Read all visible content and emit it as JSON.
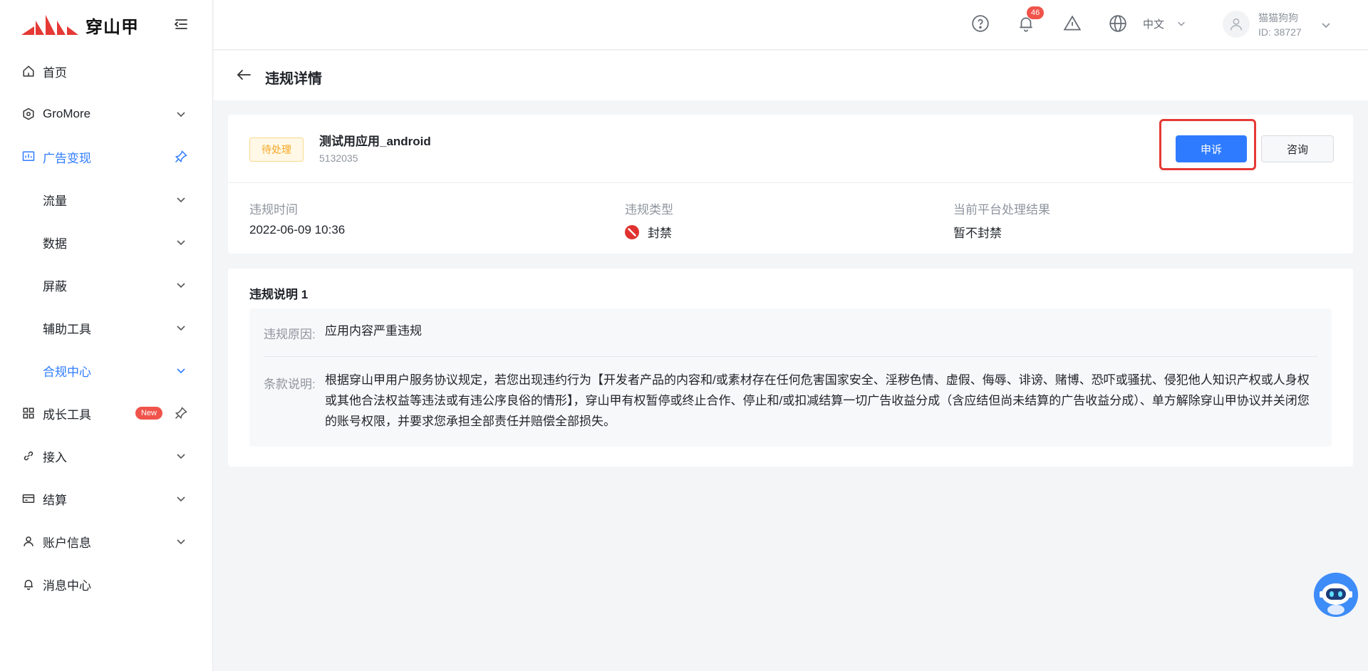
{
  "brand": {
    "name": "穿山甲",
    "accent": "#2e7bff",
    "logo_red": "#e53935"
  },
  "sidebar": {
    "items": [
      {
        "label": "首页",
        "icon": "home-icon"
      },
      {
        "label": "GroMore",
        "icon": "gromore-icon"
      },
      {
        "label": "广告变现",
        "icon": "chart-icon",
        "active": true
      },
      {
        "label": "流量"
      },
      {
        "label": "数据"
      },
      {
        "label": "屏蔽"
      },
      {
        "label": "辅助工具"
      },
      {
        "label": "合规中心",
        "active": true
      },
      {
        "label": "成长工具",
        "icon": "grid-icon",
        "badge": "New"
      },
      {
        "label": "接入",
        "icon": "link-icon"
      },
      {
        "label": "结算",
        "icon": "card-icon"
      },
      {
        "label": "账户信息",
        "icon": "user-icon"
      },
      {
        "label": "消息中心",
        "icon": "bell-icon"
      }
    ]
  },
  "header": {
    "notification_count": "46",
    "language": "中文",
    "user_name": "猫猫狗狗",
    "user_id": "ID: 38727"
  },
  "page": {
    "title": "违规详情"
  },
  "violation": {
    "status": "待处理",
    "app_name": "测试用应用_android",
    "app_id": "5132035",
    "appeal_button": "申诉",
    "consult_button": "咨询",
    "time_label": "违规时间",
    "time_value": "2022-06-09 10:36",
    "type_label": "违规类型",
    "type_value": "封禁",
    "result_label": "当前平台处理结果",
    "result_value": "暂不封禁"
  },
  "explanation": {
    "title": "违规说明 1",
    "reason_label": "违规原因:",
    "reason_value": "应用内容严重违规",
    "clause_label": "条款说明:",
    "clause_value": "根据穿山甲用户服务协议规定，若您出现违约行为【开发者产品的内容和/或素材存在任何危害国家安全、淫秽色情、虚假、侮辱、诽谤、赌博、恐吓或骚扰、侵犯他人知识产权或人身权或其他合法权益等违法或有违公序良俗的情形】，穿山甲有权暂停或终止合作、停止和/或扣减结算一切广告收益分成（含应结但尚未结算的广告收益分成）、单方解除穿山甲协议并关闭您的账号权限，并要求您承担全部责任并赔偿全部损失。"
  }
}
